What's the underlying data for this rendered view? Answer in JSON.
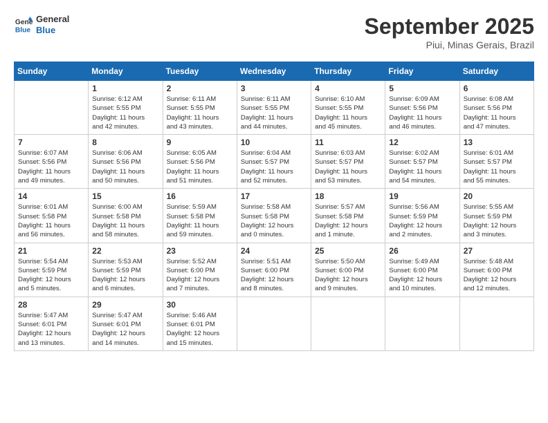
{
  "header": {
    "logo_line1": "General",
    "logo_line2": "Blue",
    "month": "September 2025",
    "location": "Piui, Minas Gerais, Brazil"
  },
  "weekdays": [
    "Sunday",
    "Monday",
    "Tuesday",
    "Wednesday",
    "Thursday",
    "Friday",
    "Saturday"
  ],
  "weeks": [
    [
      {
        "day": "",
        "info": ""
      },
      {
        "day": "1",
        "info": "Sunrise: 6:12 AM\nSunset: 5:55 PM\nDaylight: 11 hours\nand 42 minutes."
      },
      {
        "day": "2",
        "info": "Sunrise: 6:11 AM\nSunset: 5:55 PM\nDaylight: 11 hours\nand 43 minutes."
      },
      {
        "day": "3",
        "info": "Sunrise: 6:11 AM\nSunset: 5:55 PM\nDaylight: 11 hours\nand 44 minutes."
      },
      {
        "day": "4",
        "info": "Sunrise: 6:10 AM\nSunset: 5:55 PM\nDaylight: 11 hours\nand 45 minutes."
      },
      {
        "day": "5",
        "info": "Sunrise: 6:09 AM\nSunset: 5:56 PM\nDaylight: 11 hours\nand 46 minutes."
      },
      {
        "day": "6",
        "info": "Sunrise: 6:08 AM\nSunset: 5:56 PM\nDaylight: 11 hours\nand 47 minutes."
      }
    ],
    [
      {
        "day": "7",
        "info": "Sunrise: 6:07 AM\nSunset: 5:56 PM\nDaylight: 11 hours\nand 49 minutes."
      },
      {
        "day": "8",
        "info": "Sunrise: 6:06 AM\nSunset: 5:56 PM\nDaylight: 11 hours\nand 50 minutes."
      },
      {
        "day": "9",
        "info": "Sunrise: 6:05 AM\nSunset: 5:56 PM\nDaylight: 11 hours\nand 51 minutes."
      },
      {
        "day": "10",
        "info": "Sunrise: 6:04 AM\nSunset: 5:57 PM\nDaylight: 11 hours\nand 52 minutes."
      },
      {
        "day": "11",
        "info": "Sunrise: 6:03 AM\nSunset: 5:57 PM\nDaylight: 11 hours\nand 53 minutes."
      },
      {
        "day": "12",
        "info": "Sunrise: 6:02 AM\nSunset: 5:57 PM\nDaylight: 11 hours\nand 54 minutes."
      },
      {
        "day": "13",
        "info": "Sunrise: 6:01 AM\nSunset: 5:57 PM\nDaylight: 11 hours\nand 55 minutes."
      }
    ],
    [
      {
        "day": "14",
        "info": "Sunrise: 6:01 AM\nSunset: 5:58 PM\nDaylight: 11 hours\nand 56 minutes."
      },
      {
        "day": "15",
        "info": "Sunrise: 6:00 AM\nSunset: 5:58 PM\nDaylight: 11 hours\nand 58 minutes."
      },
      {
        "day": "16",
        "info": "Sunrise: 5:59 AM\nSunset: 5:58 PM\nDaylight: 11 hours\nand 59 minutes."
      },
      {
        "day": "17",
        "info": "Sunrise: 5:58 AM\nSunset: 5:58 PM\nDaylight: 12 hours\nand 0 minutes."
      },
      {
        "day": "18",
        "info": "Sunrise: 5:57 AM\nSunset: 5:58 PM\nDaylight: 12 hours\nand 1 minute."
      },
      {
        "day": "19",
        "info": "Sunrise: 5:56 AM\nSunset: 5:59 PM\nDaylight: 12 hours\nand 2 minutes."
      },
      {
        "day": "20",
        "info": "Sunrise: 5:55 AM\nSunset: 5:59 PM\nDaylight: 12 hours\nand 3 minutes."
      }
    ],
    [
      {
        "day": "21",
        "info": "Sunrise: 5:54 AM\nSunset: 5:59 PM\nDaylight: 12 hours\nand 5 minutes."
      },
      {
        "day": "22",
        "info": "Sunrise: 5:53 AM\nSunset: 5:59 PM\nDaylight: 12 hours\nand 6 minutes."
      },
      {
        "day": "23",
        "info": "Sunrise: 5:52 AM\nSunset: 6:00 PM\nDaylight: 12 hours\nand 7 minutes."
      },
      {
        "day": "24",
        "info": "Sunrise: 5:51 AM\nSunset: 6:00 PM\nDaylight: 12 hours\nand 8 minutes."
      },
      {
        "day": "25",
        "info": "Sunrise: 5:50 AM\nSunset: 6:00 PM\nDaylight: 12 hours\nand 9 minutes."
      },
      {
        "day": "26",
        "info": "Sunrise: 5:49 AM\nSunset: 6:00 PM\nDaylight: 12 hours\nand 10 minutes."
      },
      {
        "day": "27",
        "info": "Sunrise: 5:48 AM\nSunset: 6:00 PM\nDaylight: 12 hours\nand 12 minutes."
      }
    ],
    [
      {
        "day": "28",
        "info": "Sunrise: 5:47 AM\nSunset: 6:01 PM\nDaylight: 12 hours\nand 13 minutes."
      },
      {
        "day": "29",
        "info": "Sunrise: 5:47 AM\nSunset: 6:01 PM\nDaylight: 12 hours\nand 14 minutes."
      },
      {
        "day": "30",
        "info": "Sunrise: 5:46 AM\nSunset: 6:01 PM\nDaylight: 12 hours\nand 15 minutes."
      },
      {
        "day": "",
        "info": ""
      },
      {
        "day": "",
        "info": ""
      },
      {
        "day": "",
        "info": ""
      },
      {
        "day": "",
        "info": ""
      }
    ]
  ]
}
